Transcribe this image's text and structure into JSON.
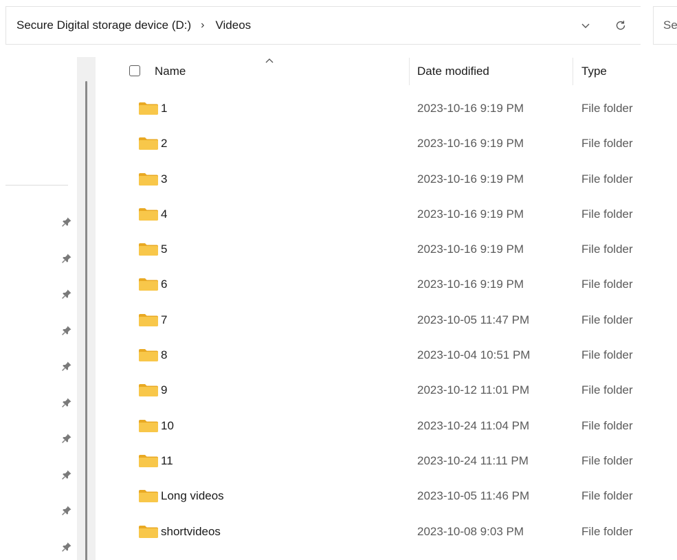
{
  "address_bar": {
    "breadcrumb": [
      {
        "label": "Secure Digital storage device (D:)"
      },
      {
        "label": "Videos"
      }
    ],
    "separator": "›",
    "history_icon": "chevron-down-icon",
    "refresh_icon": "refresh-icon"
  },
  "search": {
    "placeholder": "Se"
  },
  "nav_pane": {
    "pin_icon": "pin-icon",
    "pin_count": 10
  },
  "file_list": {
    "sort_indicator": "chevron-up-icon",
    "columns": {
      "name": "Name",
      "date_modified": "Date modified",
      "type": "Type"
    },
    "rows": [
      {
        "name": "1",
        "date": "2023-10-16 9:19 PM",
        "type": "File folder",
        "icon": "folder-icon"
      },
      {
        "name": "2",
        "date": "2023-10-16 9:19 PM",
        "type": "File folder",
        "icon": "folder-icon"
      },
      {
        "name": "3",
        "date": "2023-10-16 9:19 PM",
        "type": "File folder",
        "icon": "folder-icon"
      },
      {
        "name": "4",
        "date": "2023-10-16 9:19 PM",
        "type": "File folder",
        "icon": "folder-icon"
      },
      {
        "name": "5",
        "date": "2023-10-16 9:19 PM",
        "type": "File folder",
        "icon": "folder-icon"
      },
      {
        "name": "6",
        "date": "2023-10-16 9:19 PM",
        "type": "File folder",
        "icon": "folder-icon"
      },
      {
        "name": "7",
        "date": "2023-10-05 11:47 PM",
        "type": "File folder",
        "icon": "folder-icon"
      },
      {
        "name": "8",
        "date": "2023-10-04 10:51 PM",
        "type": "File folder",
        "icon": "folder-icon"
      },
      {
        "name": "9",
        "date": "2023-10-12 11:01 PM",
        "type": "File folder",
        "icon": "folder-icon"
      },
      {
        "name": "10",
        "date": "2023-10-24 11:04 PM",
        "type": "File folder",
        "icon": "folder-icon"
      },
      {
        "name": "11",
        "date": "2023-10-24 11:11 PM",
        "type": "File folder",
        "icon": "folder-icon"
      },
      {
        "name": "Long videos",
        "date": "2023-10-05 11:46 PM",
        "type": "File folder",
        "icon": "folder-icon"
      },
      {
        "name": "shortvideos",
        "date": "2023-10-08 9:03 PM",
        "type": "File folder",
        "icon": "folder-icon"
      }
    ]
  },
  "colors": {
    "folder": "#f8c74a",
    "folder_dark": "#e9a923",
    "muted_text": "#5a5a5a",
    "border": "#e3e3e3"
  }
}
